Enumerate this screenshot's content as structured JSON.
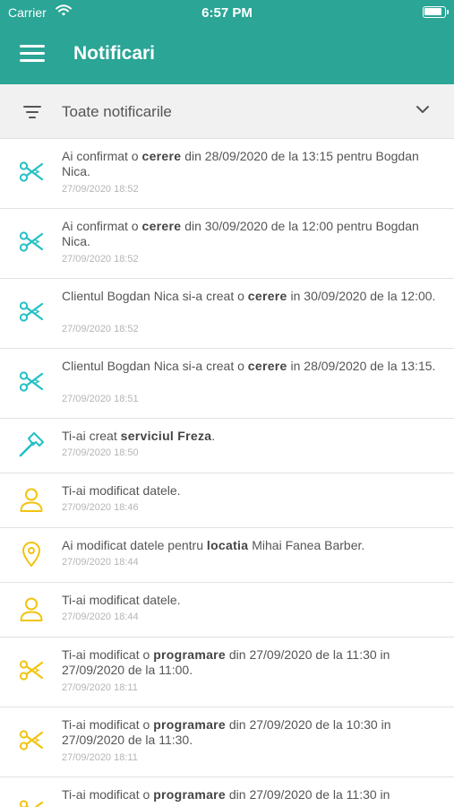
{
  "status_bar": {
    "carrier": "Carrier",
    "time": "6:57 PM"
  },
  "header": {
    "title": "Notificari"
  },
  "filter": {
    "label": "Toate notificarile"
  },
  "colors": {
    "primary": "#2aa596",
    "teal_icon": "#22c1c6",
    "yellow_icon": "#f2c40f"
  },
  "notifications": [
    {
      "icon": "scissors-icon",
      "color": "teal",
      "pre": "Ai confirmat o ",
      "bold": "cerere",
      "post": " din 28/09/2020 de la 13:15 pentru Bogdan Nica.",
      "date": "27/09/2020 18:52"
    },
    {
      "icon": "scissors-icon",
      "color": "teal",
      "pre": "Ai confirmat o ",
      "bold": "cerere",
      "post": " din 30/09/2020 de la 12:00 pentru Bogdan Nica.",
      "date": "27/09/2020 18:52"
    },
    {
      "icon": "scissors-icon",
      "color": "teal",
      "pre": "Clientul Bogdan Nica si-a creat o ",
      "bold": "cerere",
      "post": " in 30/09/2020 de la 12:00.",
      "date": "27/09/2020 18:52"
    },
    {
      "icon": "scissors-icon",
      "color": "teal",
      "pre": "Clientul Bogdan Nica si-a creat o ",
      "bold": "cerere",
      "post": " in 28/09/2020 de la 13:15.",
      "date": "27/09/2020 18:51"
    },
    {
      "icon": "hammer-icon",
      "color": "teal",
      "pre": "Ti-ai creat ",
      "bold": "serviciul Freza",
      "post": ".",
      "date": "27/09/2020 18:50"
    },
    {
      "icon": "user-icon",
      "color": "yellow",
      "pre": "Ti-ai modificat datele.",
      "bold": "",
      "post": "",
      "date": "27/09/2020 18:46"
    },
    {
      "icon": "location-pin-icon",
      "color": "yellow",
      "pre": "Ai modificat datele pentru ",
      "bold": "locatia",
      "post": " Mihai Fanea Barber.",
      "date": "27/09/2020 18:44"
    },
    {
      "icon": "user-icon",
      "color": "yellow",
      "pre": "Ti-ai modificat datele.",
      "bold": "",
      "post": "",
      "date": "27/09/2020 18:44"
    },
    {
      "icon": "scissors-icon",
      "color": "yellow",
      "pre": "Ti-ai modificat o ",
      "bold": "programare",
      "post": " din 27/09/2020 de la 11:30 in 27/09/2020 de la 11:00.",
      "date": "27/09/2020 18:11"
    },
    {
      "icon": "scissors-icon",
      "color": "yellow",
      "pre": "Ti-ai modificat o ",
      "bold": "programare",
      "post": " din 27/09/2020 de la 10:30 in 27/09/2020 de la 11:30.",
      "date": "27/09/2020 18:11"
    },
    {
      "icon": "scissors-icon",
      "color": "yellow",
      "pre": "Ti-ai modificat o ",
      "bold": "programare",
      "post": " din 27/09/2020 de la 11:30 in",
      "date": ""
    }
  ]
}
